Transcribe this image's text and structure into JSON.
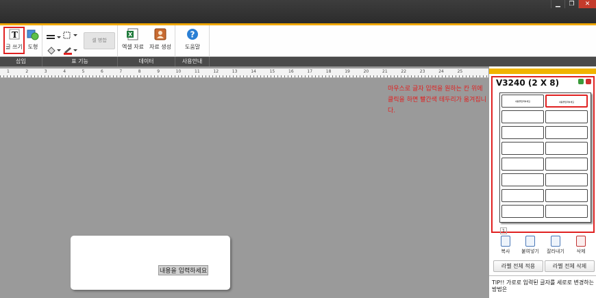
{
  "window": {
    "min": "▁",
    "max": "❐",
    "close": "✕"
  },
  "ribbon": {
    "write_text": "글 쓰기",
    "shape": "도형",
    "merge_cells": "셀 병합",
    "excel_data": "엑셀 자료",
    "data_generate": "자료 생성",
    "help": "도움말"
  },
  "categories": [
    "삽입",
    "표 기능",
    "데이터",
    "사용안내"
  ],
  "ruler_numbers": [
    "1",
    "2",
    "3",
    "4",
    "5",
    "6",
    "7",
    "8",
    "9",
    "10",
    "11",
    "12",
    "13",
    "14",
    "15",
    "16",
    "17",
    "18",
    "19",
    "20",
    "21",
    "22",
    "23",
    "24",
    "25"
  ],
  "canvas": {
    "label_text": "내용을 입력하세요"
  },
  "annotation": "마우스로 글자 입력을 원하는 칸 위에 클릭을 하면 빨간색 테두리가 옮겨집니다.",
  "preview": {
    "title": "V3240 (2 X 8)",
    "page_number": "1",
    "cell_text": "내용을입력하세요"
  },
  "actions": {
    "copy": "복사",
    "paste": "붙여넣기",
    "cut": "잘라내기",
    "delete": "삭제"
  },
  "buttons": {
    "apply_all": "라벨 전체 적용",
    "delete_all": "라벨 전체 삭제"
  },
  "tip": "TIP!! 가로로 입력된 글자를 세로로 변경하는 방법은",
  "colors": {
    "accent": "#f0a800",
    "highlight_red": "#e02020",
    "titlebar": "#333333"
  }
}
